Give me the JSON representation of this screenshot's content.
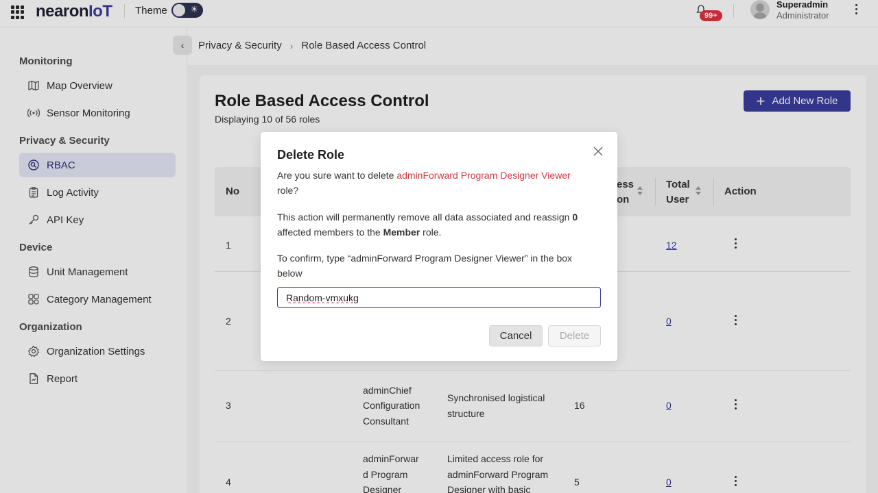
{
  "topbar": {
    "logo_main": "nearon",
    "logo_accent": "IoT",
    "theme_label": "Theme",
    "notification_count": "99+",
    "user_name": "Superadmin",
    "user_role": "Administrator"
  },
  "sidebar": {
    "sections": [
      {
        "title": "Monitoring",
        "items": [
          {
            "label": "Map Overview",
            "icon": "map-icon"
          },
          {
            "label": "Sensor Monitoring",
            "icon": "sensor-icon"
          }
        ]
      },
      {
        "title": "Privacy & Security",
        "items": [
          {
            "label": "RBAC",
            "icon": "rbac-icon",
            "active": true
          },
          {
            "label": "Log Activity",
            "icon": "log-icon"
          },
          {
            "label": "API Key",
            "icon": "key-icon"
          }
        ]
      },
      {
        "title": "Device",
        "items": [
          {
            "label": "Unit Management",
            "icon": "database-icon"
          },
          {
            "label": "Category Management",
            "icon": "category-icon"
          }
        ]
      },
      {
        "title": "Organization",
        "items": [
          {
            "label": "Organization Settings",
            "icon": "gear-icon"
          },
          {
            "label": "Report",
            "icon": "report-icon"
          }
        ]
      }
    ]
  },
  "breadcrumb": {
    "parent": "Privacy & Security",
    "current": "Role Based Access Control"
  },
  "page": {
    "title": "Role Based Access Control",
    "subtitle": "Displaying 10 of 56 roles",
    "add_button": "Add New Role"
  },
  "table": {
    "headers": {
      "no": "No",
      "access_partial_1": "ess",
      "access_partial_2": "on",
      "total_user_1": "Total",
      "total_user_2": "User",
      "action": "Action"
    },
    "rows": [
      {
        "no": "1",
        "total": "12"
      },
      {
        "no": "2",
        "total": "0"
      },
      {
        "no": "3",
        "name_1": "adminChief",
        "name_2": "Configuration",
        "name_3": "Consultant",
        "desc_1": "Synchronised logistical",
        "desc_2": "structure",
        "access": "16",
        "total": "0"
      },
      {
        "no": "4",
        "name_1": "adminForwar",
        "name_2": "d Program",
        "name_3": "Designer",
        "desc_1": "Limited access role for",
        "desc_2": "adminForward Program",
        "desc_3": "Designer with basic",
        "access": "5",
        "total": "0"
      }
    ]
  },
  "modal": {
    "title": "Delete Role",
    "question_prefix": "Are you sure want to delete ",
    "role_name": "adminForward Program Designer Viewer",
    "question_suffix": "role?",
    "warning_prefix": "This action will permanently remove all data associated and reassign ",
    "affected_count": "0",
    "warning_middle": "affected members to the ",
    "fallback_role": "Member",
    "warning_suffix": " role.",
    "confirm_instruction_1": "To confirm, type “adminForward Program Designer Viewer” in the box",
    "confirm_instruction_2": "below",
    "input_value": "Random-vmxukg",
    "cancel_label": "Cancel",
    "delete_label": "Delete"
  }
}
